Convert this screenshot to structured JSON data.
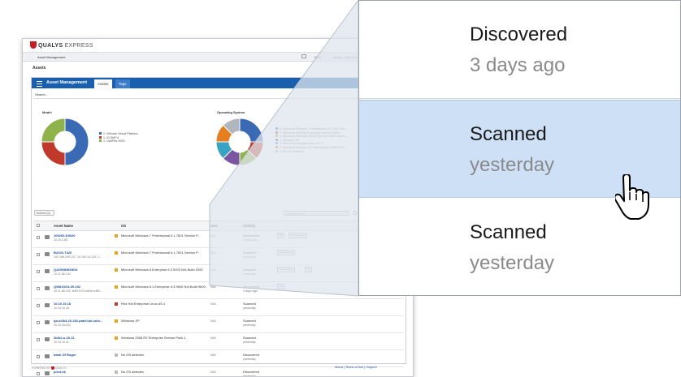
{
  "app": {
    "brand": "QUALYS",
    "product": "EXPRESS"
  },
  "nav": {
    "menu": "Asset Management",
    "help": "Help",
    "user": "qualys_lomixaaf"
  },
  "page_title": "Assets",
  "panel": {
    "title": "Asset Management",
    "tabs": [
      "Assets",
      "Tags"
    ]
  },
  "search_label": "Search...",
  "charts": {
    "model": {
      "label": "Model",
      "legend": [
        "2: VMware Virtual Platform",
        "1: 4178AFU",
        "1: OptiPlex 9020"
      ],
      "colors": [
        "#3b6ab5",
        "#c0392b",
        "#8fb24a"
      ]
    },
    "os": {
      "label": "Operating System",
      "legend": [
        "2: Microsoft Windows 7 Professional 6.1.7601 Serv...",
        "1: Windows 2008 R2 Enterprise Service Pack 1",
        "1: Microsoft Windows 8 Enterprise 6.2.9200 N/A B...",
        "1: Windows XP",
        "1: Red Hat Enterprise Linux AS 4",
        "1: Microsoft Windows 8.1 Enterprise 6.3.9600 N/A...",
        "1: No OS detected"
      ],
      "colors": [
        "#3b6ab5",
        "#c0392b",
        "#8fb24a",
        "#7a55a0",
        "#3aa3c4",
        "#e67e22",
        "#b0b7c0"
      ]
    }
  },
  "filter_label": "Actions (0)",
  "grid_search_placeholder": "Group assets by...",
  "table": {
    "headers": [
      "Asset Name",
      "OS",
      "User",
      "Activity"
    ],
    "rows": [
      {
        "name": "100260-D0020",
        "ip": "10.10.2.65",
        "os": "Microsoft Windows 7 Professional 6.1.7601 Service P...",
        "user": "N/A",
        "activity": "Discovered",
        "when": "3 days ago",
        "tags": [
          "IP",
          "Cloud Agent"
        ]
      },
      {
        "name": "B2226-T420",
        "ip": "192.168.249.137, 10.100.14.124, 1...",
        "os": "Microsoft Windows 7 Professional 6.1.7601 Service P...",
        "user": "N/A",
        "activity": "Scanned",
        "when": "yesterday",
        "tags": [
          "Cloud Agent"
        ]
      },
      {
        "name": "QAGWIN8X8G4",
        "ip": "10.11.66.144",
        "os": "Microsoft Windows 8 Enterprise 6.2.9200 N/A Build 9200",
        "user": "N/A",
        "activity": "Scanned",
        "when": "yesterday",
        "tags": [
          "Cloud Agent",
          "IP"
        ]
      },
      {
        "name": "QW81SG4-00-152",
        "ip": "10.11.66.152, fe80:0:0:0:a50e:a:f89...",
        "os": "Microsoft Windows 8.1 Enterprise 6.3.9600 N/A Build 9600",
        "user": "N/A",
        "activity": "Discovered",
        "when": "3 days ago",
        "tags": [
          "IP"
        ]
      },
      {
        "name": "10.10.10.18",
        "ip": "10.10.10.18",
        "os": "Red Hat Enterprise Linux AS 4",
        "user": "N/A",
        "activity": "Scanned",
        "when": "yesterday",
        "tags": []
      },
      {
        "name": "qa-ol3k3-26-202.patch.ad.vuln...",
        "ip": "10.10.26.202",
        "os": "Windows XP",
        "user": "N/A",
        "activity": "Scanned",
        "when": "yesterday",
        "tags": []
      },
      {
        "name": "2k8r2-u-10-11",
        "ip": "10.10.10.11",
        "os": "Windows 2008 R2 Enterprise Service Pack 1",
        "user": "N/A",
        "activity": "Scanned",
        "when": "yesterday",
        "tags": []
      },
      {
        "name": "bank Of Roger",
        "ip": "",
        "os": "No OS detected",
        "user": "N/A",
        "activity": "Discovered",
        "when": "yesterday",
        "tags": []
      },
      {
        "name": "prod-nk",
        "ip": "",
        "os": "No OS detected",
        "user": "N/A",
        "activity": "Discovered",
        "when": "yesterday",
        "tags": []
      }
    ]
  },
  "footer": {
    "powered": "POWERED BY",
    "powered_brand": "QUALYS",
    "links": "About | Terms of Use | Support"
  },
  "zoom": {
    "rows": [
      {
        "status": "Discovered",
        "when": "3 days ago"
      },
      {
        "status": "Scanned",
        "when": "yesterday"
      },
      {
        "status": "Scanned",
        "when": "yesterday"
      }
    ]
  }
}
